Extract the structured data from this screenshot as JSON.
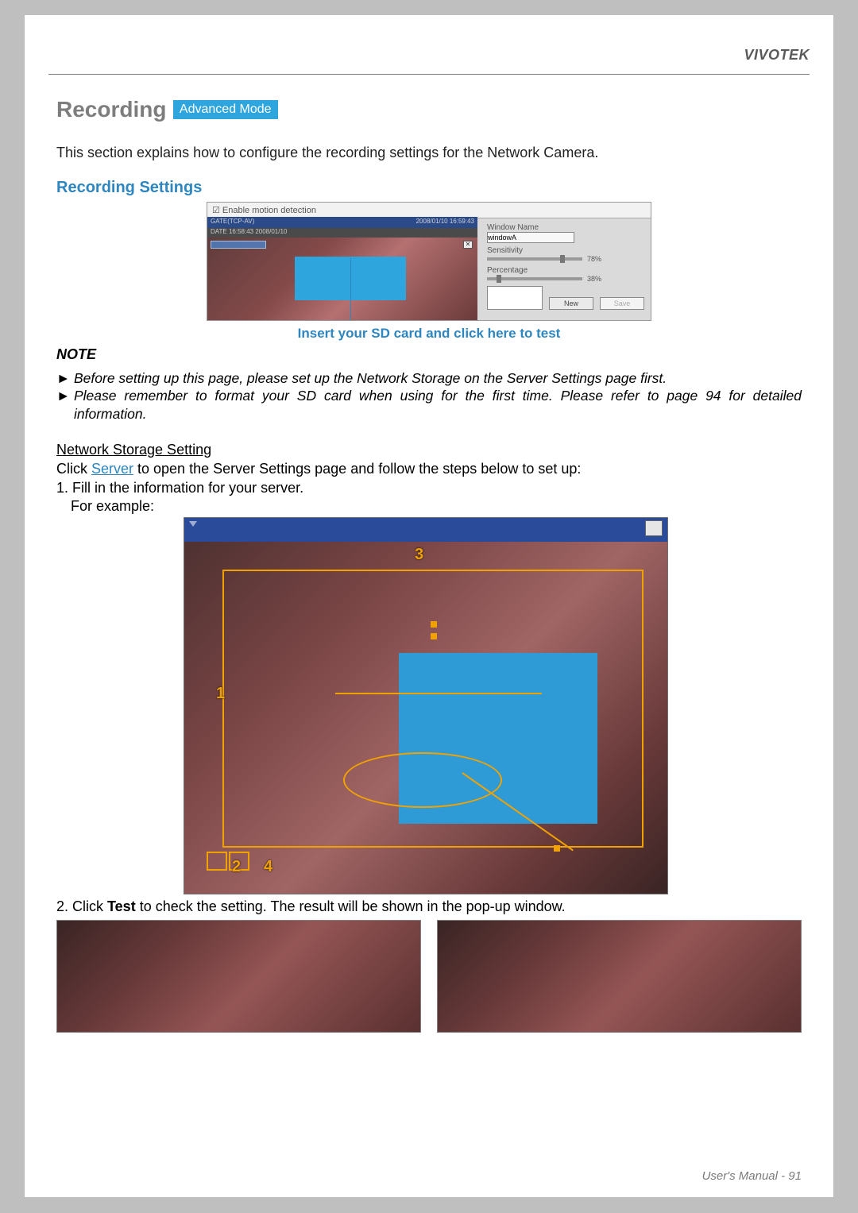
{
  "brand": "VIVOTEK",
  "heading": "Recording",
  "badge": "Advanced Mode",
  "intro": "This section explains how to configure the recording settings for the Network Camera.",
  "section_heading": "Recording Settings",
  "cue_caption": "Insert your SD card and click here to test",
  "note_heading": "NOTE",
  "notes": [
    "Before setting up this page, please set up the Network Storage on the Server Settings page first.",
    "Please remember to format your SD card when using for the first time. Please refer to page 94 for detailed information."
  ],
  "net_storage_heading": "Network Storage Setting",
  "net_storage_line_pre": "Click ",
  "net_storage_link": "Server",
  "net_storage_line_post": " to open the Server Settings page and follow the steps below to set up:",
  "step1": "1. Fill in the information for your server.",
  "for_example": "For example:",
  "step2_pre": "2. Click ",
  "step2_bold": "Test",
  "step2_post": " to check the setting. The result will be shown in the pop-up window.",
  "footer": "User's Manual - 91",
  "fig1": {
    "checkbox_label": "Enable motion detection",
    "title_left": "GATE(TCP-AV)",
    "title_right": "2008/01/10 16:59:43",
    "date_line": "DATE 16:58:43 2008/01/10",
    "close_glyph": "✕",
    "window_name_label": "Window Name",
    "window_name_value": "windowA",
    "sensitivity_label": "Sensitivity",
    "sensitivity_value": "78%",
    "percentage_label": "Percentage",
    "percentage_value": "38%",
    "new_btn": "New",
    "save_btn": "Save"
  },
  "fig2": {
    "markers": {
      "n1": "1",
      "n2": "2",
      "n3": "3",
      "n4": "4"
    }
  }
}
